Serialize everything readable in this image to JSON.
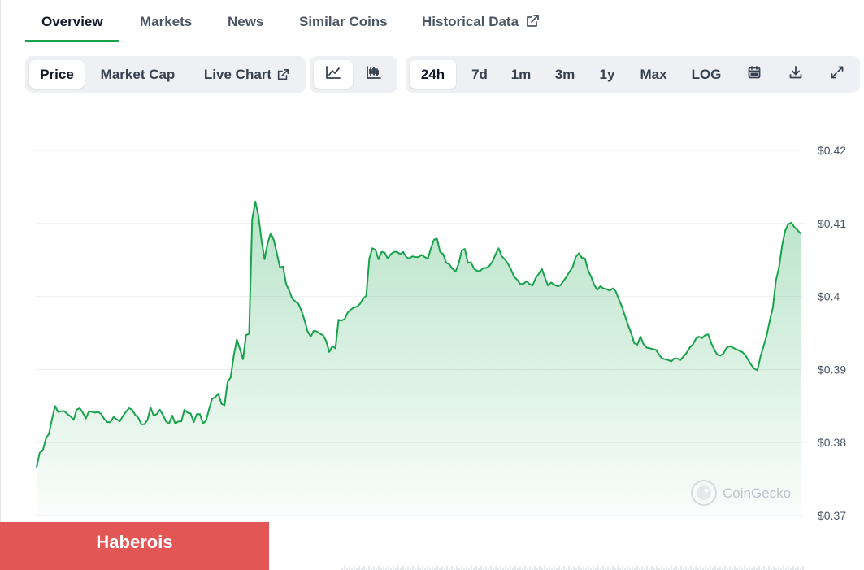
{
  "tabs": [
    {
      "label": "Overview",
      "active": true
    },
    {
      "label": "Markets"
    },
    {
      "label": "News"
    },
    {
      "label": "Similar Coins"
    },
    {
      "label": "Historical Data",
      "external": true
    }
  ],
  "toolbar": {
    "metrics": [
      {
        "label": "Price",
        "active": true
      },
      {
        "label": "Market Cap"
      },
      {
        "label": "Live Chart",
        "external": true
      }
    ],
    "chart_types": [
      {
        "icon": "line-chart-icon",
        "active": true
      },
      {
        "icon": "candlestick-chart-icon"
      }
    ],
    "ranges": [
      {
        "label": "24h",
        "active": true
      },
      {
        "label": "7d"
      },
      {
        "label": "1m"
      },
      {
        "label": "3m"
      },
      {
        "label": "1y"
      },
      {
        "label": "Max"
      },
      {
        "label": "LOG"
      }
    ],
    "actions": [
      "calendar-icon",
      "download-icon",
      "expand-icon"
    ]
  },
  "colors": {
    "line": "#16a34a",
    "fill_top": "#16a34a",
    "banner": "#e25656",
    "tab_underline": "#16a34a"
  },
  "watermark": "CoinGecko",
  "banner": {
    "text": "Haberois"
  },
  "chart_data": {
    "type": "area",
    "title": "",
    "xlabel": "",
    "ylabel": "",
    "yaxis_position": "right",
    "ylim": [
      0.37,
      0.42
    ],
    "y_tick_labels": [
      "$0.42",
      "$0.41",
      "$0.4",
      "$0.39",
      "$0.38",
      "$0.37"
    ],
    "y_ticks": [
      0.42,
      0.41,
      0.4,
      0.39,
      0.38,
      0.37
    ],
    "grid": true,
    "x_range": "24h",
    "series": [
      {
        "values": [
          0.3766,
          0.3786,
          0.3789,
          0.3805,
          0.3812,
          0.3832,
          0.385,
          0.3842,
          0.3843,
          0.3843,
          0.3839,
          0.3836,
          0.3831,
          0.3845,
          0.3847,
          0.3841,
          0.3833,
          0.3843,
          0.3842,
          0.3841,
          0.3842,
          0.3839,
          0.3832,
          0.3828,
          0.3828,
          0.3835,
          0.3832,
          0.3829,
          0.3836,
          0.3842,
          0.3847,
          0.3845,
          0.3838,
          0.3834,
          0.3825,
          0.3825,
          0.3831,
          0.3848,
          0.3837,
          0.3839,
          0.3845,
          0.3838,
          0.3829,
          0.3826,
          0.3837,
          0.3826,
          0.3829,
          0.3829,
          0.3845,
          0.3841,
          0.384,
          0.3828,
          0.3839,
          0.3839,
          0.3826,
          0.383,
          0.3846,
          0.386,
          0.3862,
          0.3867,
          0.3853,
          0.3851,
          0.3883,
          0.3889,
          0.3919,
          0.3941,
          0.3928,
          0.3914,
          0.3947,
          0.3949,
          0.4106,
          0.413,
          0.4111,
          0.4077,
          0.4051,
          0.4073,
          0.4087,
          0.4077,
          0.4059,
          0.404,
          0.4041,
          0.4017,
          0.4008,
          0.3997,
          0.3993,
          0.399,
          0.398,
          0.3967,
          0.3952,
          0.3945,
          0.3953,
          0.3952,
          0.3949,
          0.3947,
          0.3939,
          0.3924,
          0.3932,
          0.3929,
          0.3968,
          0.3967,
          0.3969,
          0.3978,
          0.3982,
          0.3985,
          0.3986,
          0.399,
          0.3997,
          0.4001,
          0.4052,
          0.4066,
          0.4064,
          0.4051,
          0.4061,
          0.406,
          0.4052,
          0.4058,
          0.4061,
          0.4061,
          0.4058,
          0.4061,
          0.4054,
          0.4052,
          0.4055,
          0.4054,
          0.4054,
          0.4057,
          0.4054,
          0.4052,
          0.4066,
          0.4078,
          0.4079,
          0.4061,
          0.4058,
          0.4046,
          0.4044,
          0.4038,
          0.4034,
          0.4045,
          0.4063,
          0.4065,
          0.4046,
          0.4047,
          0.4038,
          0.4035,
          0.4035,
          0.4039,
          0.4039,
          0.4042,
          0.4048,
          0.4058,
          0.4066,
          0.4055,
          0.4051,
          0.4045,
          0.4037,
          0.4027,
          0.4023,
          0.4017,
          0.4017,
          0.4021,
          0.4017,
          0.4015,
          0.4025,
          0.4031,
          0.4038,
          0.4026,
          0.4015,
          0.4019,
          0.4016,
          0.4014,
          0.4015,
          0.4021,
          0.4027,
          0.4034,
          0.404,
          0.4054,
          0.4059,
          0.4053,
          0.4052,
          0.4036,
          0.4027,
          0.4016,
          0.4009,
          0.4014,
          0.4011,
          0.401,
          0.4008,
          0.4011,
          0.4007,
          0.3996,
          0.3986,
          0.3973,
          0.3961,
          0.395,
          0.3936,
          0.3934,
          0.3945,
          0.3935,
          0.393,
          0.3929,
          0.3928,
          0.3927,
          0.3921,
          0.3915,
          0.3914,
          0.3913,
          0.3911,
          0.3915,
          0.3915,
          0.3913,
          0.3918,
          0.3923,
          0.393,
          0.3934,
          0.3942,
          0.3945,
          0.3943,
          0.3947,
          0.3948,
          0.3936,
          0.3927,
          0.392,
          0.3919,
          0.3922,
          0.393,
          0.3932,
          0.393,
          0.3928,
          0.3926,
          0.3924,
          0.392,
          0.3913,
          0.3906,
          0.3901,
          0.3899,
          0.3918,
          0.3932,
          0.3947,
          0.3967,
          0.3985,
          0.4022,
          0.404,
          0.407,
          0.409,
          0.4099,
          0.4101,
          0.4095,
          0.4091,
          0.4086
        ]
      }
    ]
  }
}
